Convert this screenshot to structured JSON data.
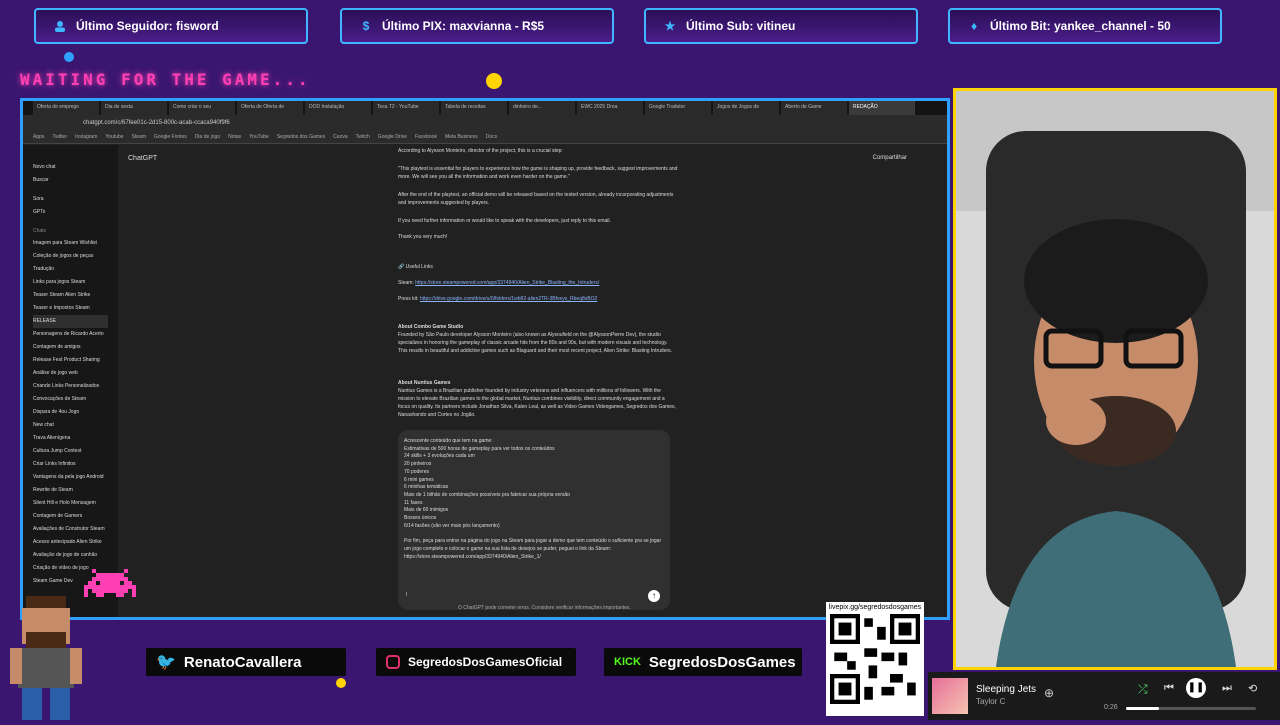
{
  "alerts": {
    "follower": "Último Seguidor: fisword",
    "pix": "Último PIX: maxvianna - R$5",
    "sub": "Último Sub: vitineu",
    "bit": "Último Bit: yankee_channel - 50"
  },
  "waiting": "WAITING FOR THE GAME...",
  "browser": {
    "tabs": [
      "Oferta de emprego",
      "Dia de sexta",
      "Como criar o seu",
      "Oferta de Oferta de",
      "DOD Instalação",
      "Tesa T2 - YouTube",
      "Tabela de receitas",
      "dinheiro de...",
      "EWC 2025 Drea",
      "Google Tradutor",
      "Jogos de Jogos de",
      "Aberto de Game",
      "REDAÇÃO"
    ],
    "url": "chatgpt.com/c/67fee01c-2d15-800c-acab-ccaca940f9f6",
    "bookmarks": [
      "Apps",
      "Twitter",
      "Instagram",
      "Youtube",
      "Steam",
      "Google Fontes",
      "Dia de jogo",
      "Notas",
      "YouTube",
      "Segredos dos Games",
      "Canva",
      "Twitch",
      "Google Drive",
      "Facebook",
      "Meta Business",
      "Docs"
    ],
    "sidebar": {
      "new_chat": "Novo chat",
      "search": "Buscar",
      "sora": "Sora",
      "gpts": "GPTs",
      "section": "Chats",
      "items": [
        "Imagem para Steam Wishlist",
        "Coleção de jogos de peças",
        "Tradução",
        "Links para jogos Steam",
        "Teaser Steam Alien Strike",
        "Teaser e Impostos Steam",
        "RELEASE",
        "Personagens de Ricardo Acerto",
        "Contagem de amigos",
        "Release Fest Product Sharing",
        "Análise de jogo web",
        "Criando Links Personalizados",
        "Convocações de Steam",
        "Dispara de 4ou Jogo",
        "New chat",
        "Trava Alienígena",
        "Cultura Jump Contest",
        "Criar Links Infinitos",
        "Vantagens da pela jogo Android",
        "Rewrite de Steam",
        "Silent Hill e Holo Mensagem",
        "Contagem de Gamers",
        "Avaliações de Construtor Steam",
        "Acesso antecipado Alien Strike",
        "Avaliação de jogo de canhão",
        "Criação de vídeo de jogo",
        "Steam Game Dev"
      ]
    },
    "chat_title": "ChatGPT",
    "share": "Compartilhar",
    "content": {
      "p1": "According to Alysson Monteiro, director of the project, this is a crucial step:",
      "p2": "\"This playtest is essential for players to experience how the game is shaping up, provide feedback, suggest improvements and more. We will see you all the information and work even harder on the game.\"",
      "p3": "After the end of the playtest, an official demo will be released based on the tested version, already incorporating adjustments and improvements suggested by players.",
      "p4": "If you need further information or would like to speak with the developers, just reply to this email.",
      "p5": "Thank you very much!",
      "useful": "Useful Links",
      "steam_label": "Steam:",
      "steam_url": "https://store.steampowered.com/app/3374940/Alien_Strike_Blasting_the_Intruders/",
      "press_label": "Press kit:",
      "press_url": "https://drive.google.com/drive/u/0/folders/1wb82-alien2TR-3Bfveys_Rbeq8xBO2",
      "about_combo": "About Combo Game Studio",
      "combo_text": "Founded by São Paulo developer Alysson Monteiro (also known as Alysoufield on the @AlyssonPierre Dev), the studio specializes in honoring the gameplay of classic arcade hits from the 80s and 90s, but with modern visuals and technology. This results in beautiful and addictive games such as Blaguard and their most recent project, Alien Strike: Blasting Intruders.",
      "about_nuntius": "About Nuntius Games",
      "nuntius_text": "Nuntius Games is a Brazilian publisher founded by industry veterans and influencers with millions of followers. With the mission to elevate Brazilian games to the global market, Nuntius combines visibility, direct community engagement and a focus on quality. Its partners include Jonathan Silva, Kalen Leal, as well as Video Games Videogames, Segredos dos Games, Nanashando and Cortes no Jogão."
    },
    "composer_lines": [
      "Acrescente conteúdo que tem na game:",
      "Estimativas de 500 horas de gameplay para ver todos os conteúdos",
      "24 skills + 3 evoluções cada um",
      "20 pinheiros",
      "70 poderes",
      "6 mini games",
      "6 minihas temáticas",
      "Mais de 1 bilhão de combinações possíveis pra fabricar sua própria versão",
      "11 fases",
      "Mais de 60 inimigos",
      "Bosses únicos",
      "6/14 fasões (vão ver mais pós lançamento)",
      "",
      "Por fim, peça para entrar na página do jogo na Steam para jogar a demo que tem conteúdo o suficiente pra se jogar um jogo completo e colocar o game na sua lista de desejos se puder, peguei o link da Steam: https://store.steampowered.com/app/3374940/Alien_Strike_1/"
    ],
    "composer_input": "I",
    "disclaimer": "O ChatGPT pode cometer erros. Considere verificar informações importantes."
  },
  "socials": {
    "twitter": "RenatoCavallera",
    "instagram": "SegredosDosGamesOficial",
    "kick_badge": "KICK",
    "kick": "SegredosDosGames"
  },
  "qr_url": "livepix.gg/segredosdosgames",
  "player": {
    "song": "Sleeping Jets",
    "artist": "Taylor C",
    "time": "0:26",
    "progress": 0.25
  },
  "colors": {
    "accent": "#2fa0ff",
    "webcam_border": "#ffd400",
    "waiting": "#ff3fb3",
    "bg": "#3b1670"
  }
}
